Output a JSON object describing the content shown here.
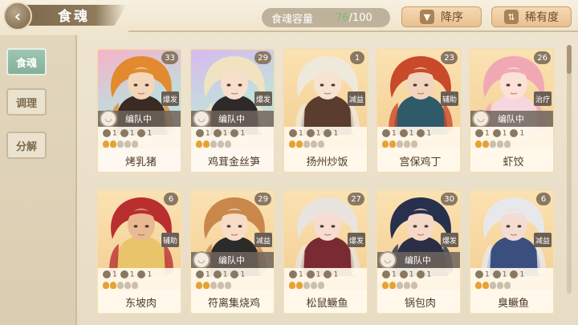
{
  "header": {
    "title": "食魂",
    "capacity_label": "食魂容量",
    "capacity_current": "76",
    "capacity_max": "/100",
    "sort_label": "降序",
    "rarity_label": "稀有度"
  },
  "sidebar": {
    "tabs": [
      {
        "label": "食魂",
        "active": true
      },
      {
        "label": "调理",
        "active": false
      },
      {
        "label": "分解",
        "active": false
      }
    ]
  },
  "cards": [
    {
      "name": "烤乳猪",
      "level": "33",
      "role": "爆发",
      "team": "编队中",
      "style": "gradA",
      "hair": "#e38a2e",
      "skin": "#f4d6b8",
      "outfit": "#3a2b25",
      "stars": "1",
      "s2": "1",
      "s3": "1"
    },
    {
      "name": "鸡茸金丝笋",
      "level": "29",
      "role": "爆发",
      "team": "编队中",
      "style": "gradB",
      "hair": "#f1e2c2",
      "skin": "#f7dfcb",
      "outfit": "#2f2a2a",
      "stars": "1",
      "s2": "1",
      "s3": "1"
    },
    {
      "name": "扬州炒饭",
      "level": "1",
      "role": "减益",
      "team": "",
      "style": "",
      "hair": "#efe9dc",
      "skin": "#f8e3d3",
      "outfit": "#5a3d2e",
      "stars": "1",
      "s2": "1",
      "s3": "1"
    },
    {
      "name": "宫保鸡丁",
      "level": "23",
      "role": "辅助",
      "team": "",
      "style": "",
      "hair": "#c84a2b",
      "skin": "#f3d4bf",
      "outfit": "#2e5a6a",
      "stars": "1",
      "s2": "1",
      "s3": "1"
    },
    {
      "name": "虾饺",
      "level": "26",
      "role": "治疗",
      "team": "编队中",
      "style": "",
      "hair": "#f1a8b5",
      "skin": "#fbe1d8",
      "outfit": "#f6d7e0",
      "stars": "1",
      "s2": "1",
      "s3": "1"
    },
    {
      "name": "东坡肉",
      "level": "6",
      "role": "辅助",
      "team": "",
      "style": "",
      "hair": "#b92f2f",
      "skin": "#e9b994",
      "outfit": "#e9c46a",
      "stars": "1",
      "s2": "1",
      "s3": "1"
    },
    {
      "name": "符离集烧鸡",
      "level": "29",
      "role": "减益",
      "team": "编队中",
      "style": "",
      "hair": "#c9874b",
      "skin": "#f7dcc6",
      "outfit": "#2d2a2a",
      "stars": "1",
      "s2": "1",
      "s3": "1"
    },
    {
      "name": "松鼠鳜鱼",
      "level": "27",
      "role": "爆发",
      "team": "",
      "style": "",
      "hair": "#e9e4de",
      "skin": "#f6dcd1",
      "outfit": "#7a2a33",
      "stars": "1",
      "s2": "1",
      "s3": "1"
    },
    {
      "name": "锅包肉",
      "level": "30",
      "role": "爆发",
      "team": "编队中",
      "style": "",
      "hair": "#27304d",
      "skin": "#f5d8c8",
      "outfit": "#2b2f46",
      "stars": "1",
      "s2": "1",
      "s3": "1"
    },
    {
      "name": "臭鳜鱼",
      "level": "6",
      "role": "减益",
      "team": "",
      "style": "",
      "hair": "#e8e8ec",
      "skin": "#f4dcd2",
      "outfit": "#3b4f7f",
      "stars": "1",
      "s2": "1",
      "s3": "1"
    }
  ]
}
